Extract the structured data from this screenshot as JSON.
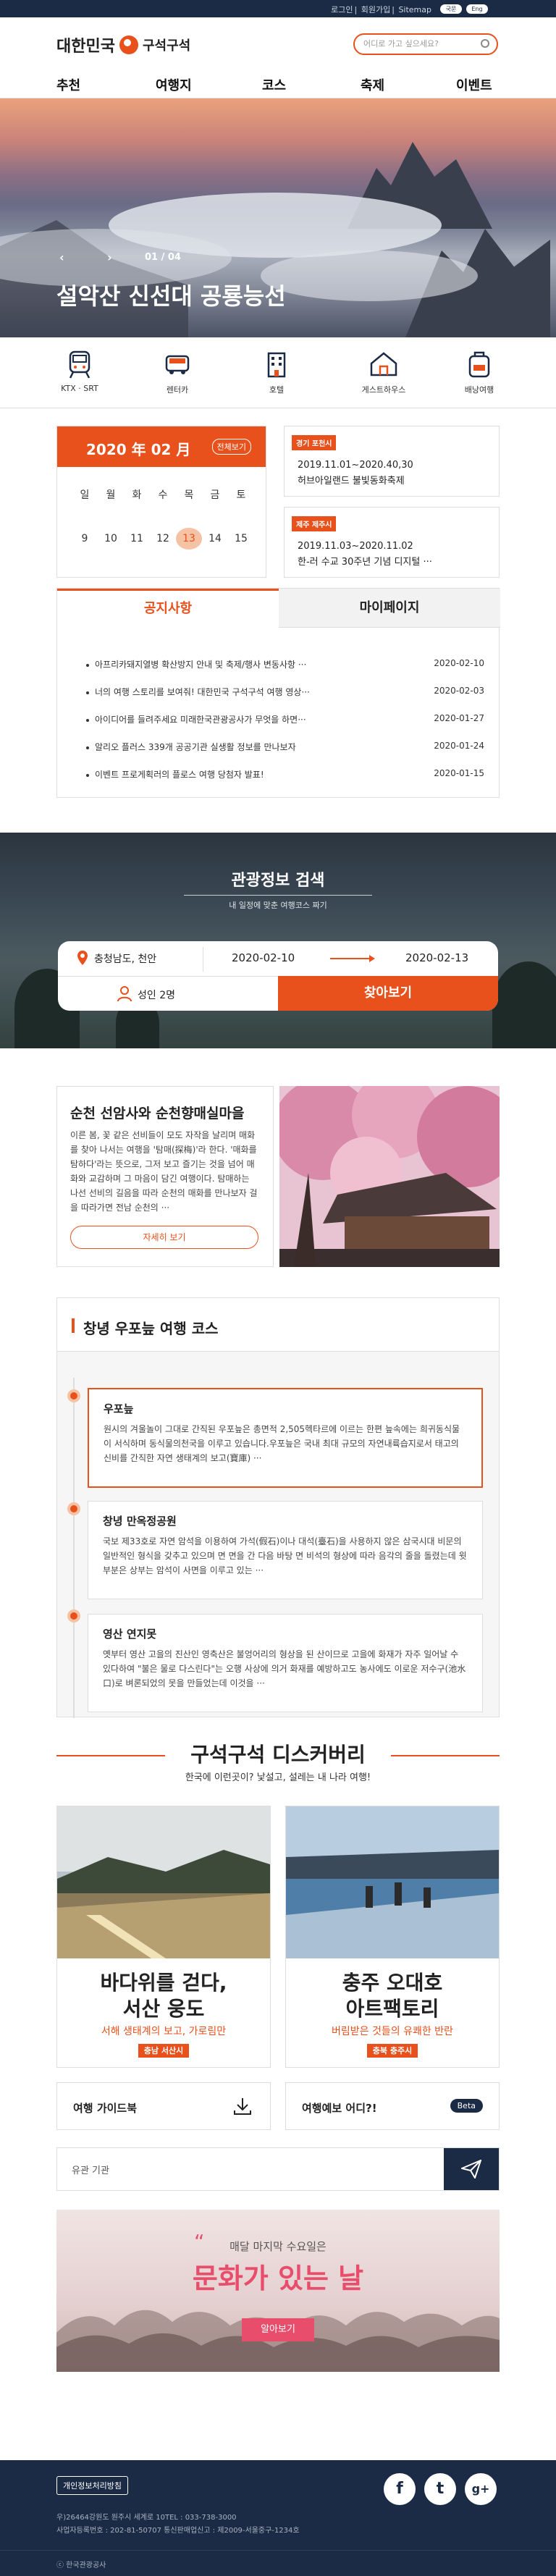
{
  "topbar": {
    "links": [
      "로그인",
      "회원가입",
      "Sitemap"
    ],
    "lang": [
      "국문",
      "Eng"
    ]
  },
  "header": {
    "brand": "대한민국",
    "brand2": "구석구석",
    "search_placeholder": "어디로 가고 싶으세요?"
  },
  "nav": [
    "추천",
    "여행지",
    "코스",
    "축제",
    "이벤트"
  ],
  "hero": {
    "prev": "‹",
    "next": "›",
    "counter": "01 / 04",
    "title": "설악산 신선대 공룡능선"
  },
  "quick": [
    {
      "label": "KTX · SRT",
      "icon": "train-icon"
    },
    {
      "label": "렌터카",
      "icon": "rentcar-icon"
    },
    {
      "label": "호텔",
      "icon": "hotel-icon"
    },
    {
      "label": "게스트하우스",
      "icon": "guesthouse-icon"
    },
    {
      "label": "배낭여행",
      "icon": "backpack-icon"
    }
  ],
  "calendar": {
    "month": "2020 年 02 月",
    "all": "전체보기",
    "days": [
      "일",
      "월",
      "화",
      "수",
      "목",
      "금",
      "토"
    ],
    "dates": [
      "9",
      "10",
      "11",
      "12",
      "13",
      "14",
      "15"
    ],
    "today": "13"
  },
  "events": [
    {
      "tag": "경기 포천시",
      "date": "2019.11.01~2020.40,30",
      "title": "허브아일랜드 불빛동화축제"
    },
    {
      "tag": "제주 제주시",
      "date": "2019.11.03~2020.11.02",
      "title": "한-러 수교 30주년 기념 디지털 ···"
    }
  ],
  "notice": {
    "tab1": "공지사항",
    "tab2": "마이페이지",
    "items": [
      {
        "t": "아프리카돼지열병 확산방지 안내 및 축제/행사 변동사항 ···",
        "d": "2020-02-10"
      },
      {
        "t": "너의 여행 스토리를 보여줘! 대한민국 구석구석 여행 영상···",
        "d": "2020-02-03"
      },
      {
        "t": "아이디어를 들려주세요 미래한국관광공사가 무엇을 하면···",
        "d": "2020-01-27"
      },
      {
        "t": "알리오 플러스 339개 공공기관 실생활 정보를 만나보자",
        "d": "2020-01-24"
      },
      {
        "t": "이벤트 프로게획러의 플로스 여행 당첨자 발표!",
        "d": "2020-01-15"
      }
    ]
  },
  "tsearch": {
    "title": "관광정보 검색",
    "sub": "내 일정에 맞춘 여행코스 짜기",
    "loc": "충청남도, 천안",
    "from": "2020-02-10",
    "to": "2020-02-13",
    "people": "성인 2명",
    "go": "찾아보기"
  },
  "feature": {
    "title": "순천 선암사와 순천향매실마을",
    "body": "이른 봄, 꽃 같은 선비들이 모도 자작을 날리며 매화를 찾아 나서는 여행을 '탐매(探梅)'라 한다. '매화를 탐하다'라는 뜻으로, 그저 보고 즐기는 것을 넘어 매화와 교감하며 그 마음이 담긴 여행이다. 탐매하는 나선 선비의 길음을 따라 순천의 매화를 만나보자 걸을 따라가면 전남 순천의 ···",
    "btn": "자세히 보기"
  },
  "course": {
    "title": "창녕 우포늪 여행 코스",
    "items": [
      {
        "t": "우포늪",
        "d": "원시의 겨울놀이 그대로 간직된 우포늪은 총면적 2,505헥타르에 이르는 한편 늪속에는 희귀동식물이 서식하며 동식물의천국을 이루고 있습니다.우포늪은 국내 최대 규모의 자연내륙습지로서 태고의 신비를 간직한 자연 생태계의 보고(寶庫) ···"
      },
      {
        "t": "창녕 만옥정공원",
        "d": "국보 제33호로 자연 암석을 이용하여 가석(假石)이나 대석(臺石)을 사용하지 않은 삼국시대 비문의 일반적인 형식을 갖추고 있으며 면 면을 간 다음 바탕 면 비석의 형상에 따라 음각의 줄을 돌렸는데 윗부분은 상부는 암석이 사면을 이루고 있는 ···"
      },
      {
        "t": "영산 연지못",
        "d": "옛부터 영산 고을의 진산인 영축산은 불엉어리의 형상을 된 산이므로 고을에 화재가 자주 일어날 수 있다하여 \"불은 물로 다스린다\"는 오행 사상에 의거 화재를 예방하고도 농사에도 이로운 저수구(池水口)로 벼론되었의 못을 만들었는데 이것을 ···"
      }
    ]
  },
  "discovery": {
    "title": "구석구석 디스커버리",
    "sub": "한국에 이런곳이? 낯설고, 설레는 내 나라 여행!",
    "cards": [
      {
        "t1": "바다위를 걷다,",
        "t2": "서산 웅도",
        "s": "서해 생태계의 보고, 가로림만",
        "b": "충남 서산시"
      },
      {
        "t1": "충주 오대호",
        "t2": "아트팩토리",
        "s": "버림받은 것들의 유쾌한 반란",
        "b": "충북 충주시"
      }
    ]
  },
  "guide": {
    "g1": "여행 가이드북",
    "g2": "여행예보 어디?!",
    "beta": "Beta"
  },
  "subscribe": {
    "placeholder": "유관 기관"
  },
  "ad": {
    "small": "매달 마지막 수요일은",
    "big": "문화가 있는 날",
    "btn": "알아보기",
    "quote": "“"
  },
  "footer": {
    "policy": "개인정보처리방침",
    "addr1": "우)26464강원도 원주시 세계로 10TEL : 033-738-3000",
    "addr2": "사업자등록번호 : 202-81-50707 통신판매업신고 : 제2009-서울중구-1234호",
    "copy": "ⓒ 한국관광공사",
    "sns": [
      "f",
      "t",
      "g+"
    ]
  },
  "colors": {
    "accent": "#e8501c",
    "navy": "#1b2b45",
    "pink": "#e94d6c"
  }
}
